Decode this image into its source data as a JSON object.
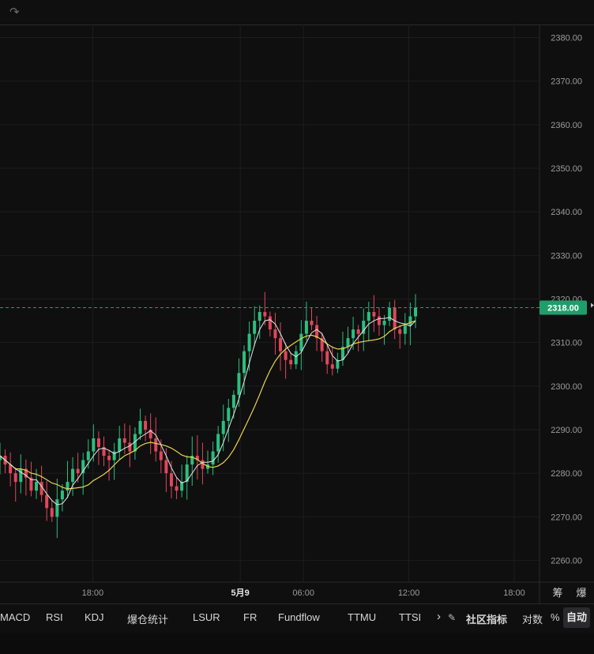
{
  "chart_data": {
    "type": "candlestick",
    "y_ticks": [
      "2380.00",
      "2370.00",
      "2360.00",
      "2350.00",
      "2340.00",
      "2330.00",
      "2320.00",
      "2310.00",
      "2300.00",
      "2290.00",
      "2280.00",
      "2270.00",
      "2260.00"
    ],
    "ylim": [
      2255,
      2383
    ],
    "x_ticks": [
      {
        "label": "18:00",
        "x": 0.9
      },
      {
        "label": "5月9",
        "x": 1.25
      },
      {
        "label": "06:00",
        "x": 1.4
      },
      {
        "label": "12:00",
        "x": 1.65
      },
      {
        "label": "18:00",
        "x": 1.9
      }
    ],
    "x_tick_bold": [
      "5月9"
    ],
    "xlim": [
      0.68,
      1.96
    ],
    "last_price": "2318.00",
    "last_price_value": 2318,
    "colors": {
      "up": "#2bbf7e",
      "down": "#e0475a",
      "ma_fast": "#e6e6e6",
      "ma_slow": "#e8d54a",
      "price_tag": "#1f9e6c",
      "grid": "#1d1d1f"
    },
    "series": [
      {
        "values_close": [
          2284,
          2282,
          2280,
          2278,
          2281,
          2279,
          2276,
          2278,
          2275,
          2272,
          2270,
          2274,
          2276,
          2278,
          2281,
          2280,
          2283,
          2285,
          2288,
          2286,
          2284,
          2283,
          2285,
          2288,
          2287,
          2285,
          2289,
          2292,
          2290,
          2288,
          2285,
          2283,
          2280,
          2277,
          2276,
          2278,
          2282,
          2284,
          2283,
          2281,
          2282,
          2285,
          2289,
          2292,
          2295,
          2298,
          2303,
          2308,
          2312,
          2315,
          2317,
          2316,
          2313,
          2311,
          2308,
          2306,
          2305,
          2308,
          2312,
          2315,
          2314,
          2311,
          2308,
          2305,
          2304,
          2306,
          2309,
          2311,
          2313,
          2312,
          2315,
          2317,
          2316,
          2314,
          2315,
          2318,
          2313,
          2312,
          2314,
          2316,
          2318
        ]
      }
    ]
  },
  "header": {
    "redo_icon": "redo-arrow-icon"
  },
  "corner_labels": {
    "chips": "筹",
    "liquidation": "爆"
  },
  "bottom_tabs": [
    "MACD",
    "RSI",
    "KDJ",
    "爆仓统计",
    "LSUR",
    "FR",
    "Fundflow",
    "TTMU",
    "TTSI"
  ],
  "bottom_right": {
    "more": "›",
    "edit_icon": "edit-icon",
    "community": "社区指标",
    "log": "对数",
    "percent": "%",
    "auto": "自动"
  }
}
